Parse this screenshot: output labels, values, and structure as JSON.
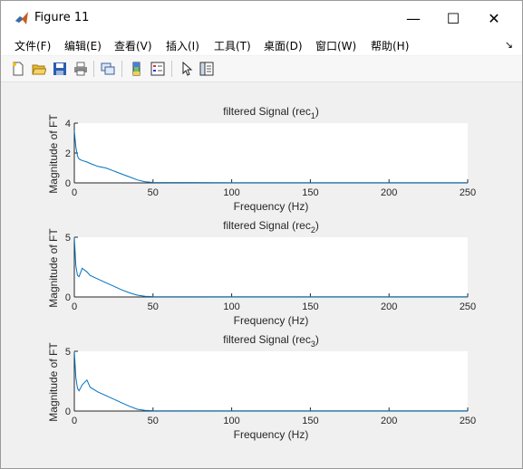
{
  "window": {
    "title": "Figure 11"
  },
  "controls": {
    "minimize": "—",
    "maximize": "☐",
    "close": "✕"
  },
  "menu": [
    "文件(F)",
    "编辑(E)",
    "查看(V)",
    "插入(I)",
    "工具(T)",
    "桌面(D)",
    "窗口(W)",
    "帮助(H)"
  ],
  "menu_overflow_icon": "arrow-icon",
  "toolbar": [
    "new-figure-icon",
    "open-file-icon",
    "save-icon",
    "print-icon",
    "link-plot-icon",
    "colorbar-icon",
    "legend-icon",
    "pointer-icon",
    "property-editor-icon"
  ],
  "colors": {
    "line": "#0072bd",
    "axes_bg": "#ffffff",
    "figure_bg": "#f0f0f0"
  },
  "chart_data": [
    {
      "type": "line",
      "title": "filtered Signal (rec1)",
      "title_base": "filtered Signal (rec",
      "title_sub": "1",
      "title_close": ")",
      "xlabel": "Frequency (Hz)",
      "ylabel": "Magnitude of FT",
      "xlim": [
        0,
        250
      ],
      "ylim": [
        0,
        4
      ],
      "xticks": [
        0,
        50,
        100,
        150,
        200,
        250
      ],
      "yticks": [
        0,
        2,
        4
      ],
      "series": [
        {
          "x": [
            0,
            1,
            2,
            3,
            5,
            8,
            10,
            15,
            20,
            25,
            30,
            35,
            40,
            45,
            50,
            100,
            150,
            200,
            250
          ],
          "y": [
            3.5,
            2.4,
            1.8,
            1.6,
            1.5,
            1.4,
            1.3,
            1.1,
            1.0,
            0.8,
            0.6,
            0.4,
            0.2,
            0.08,
            0.03,
            0.02,
            0.02,
            0.02,
            0.02
          ]
        }
      ]
    },
    {
      "type": "line",
      "title": "filtered Signal (rec2)",
      "title_base": "filtered Signal (rec",
      "title_sub": "2",
      "title_close": ")",
      "xlabel": "Frequency (Hz)",
      "ylabel": "Magnitude of FT",
      "xlim": [
        0,
        250
      ],
      "ylim": [
        0,
        5
      ],
      "xticks": [
        0,
        50,
        100,
        150,
        200,
        250
      ],
      "yticks": [
        0,
        5
      ],
      "series": [
        {
          "x": [
            0,
            1,
            2,
            3,
            5,
            8,
            10,
            15,
            20,
            25,
            30,
            35,
            40,
            45,
            50,
            100,
            150,
            200,
            250
          ],
          "y": [
            5.0,
            2.6,
            1.8,
            1.7,
            2.4,
            2.1,
            1.8,
            1.5,
            1.2,
            0.9,
            0.6,
            0.35,
            0.15,
            0.06,
            0.03,
            0.02,
            0.02,
            0.02,
            0.02
          ]
        }
      ]
    },
    {
      "type": "line",
      "title": "filtered Signal (rec3)",
      "title_base": "filtered Signal (rec",
      "title_sub": "3",
      "title_close": ")",
      "xlabel": "Frequency (Hz)",
      "ylabel": "Magnitude of FT",
      "xlim": [
        0,
        250
      ],
      "ylim": [
        0,
        5
      ],
      "xticks": [
        0,
        50,
        100,
        150,
        200,
        250
      ],
      "yticks": [
        0,
        5
      ],
      "series": [
        {
          "x": [
            0,
            1,
            2,
            3,
            5,
            8,
            10,
            15,
            20,
            25,
            30,
            35,
            40,
            45,
            50,
            100,
            150,
            200,
            250
          ],
          "y": [
            5.0,
            2.8,
            1.9,
            1.7,
            2.2,
            2.6,
            2.0,
            1.6,
            1.3,
            1.0,
            0.7,
            0.4,
            0.15,
            0.06,
            0.03,
            0.02,
            0.02,
            0.02,
            0.02
          ]
        }
      ]
    }
  ]
}
